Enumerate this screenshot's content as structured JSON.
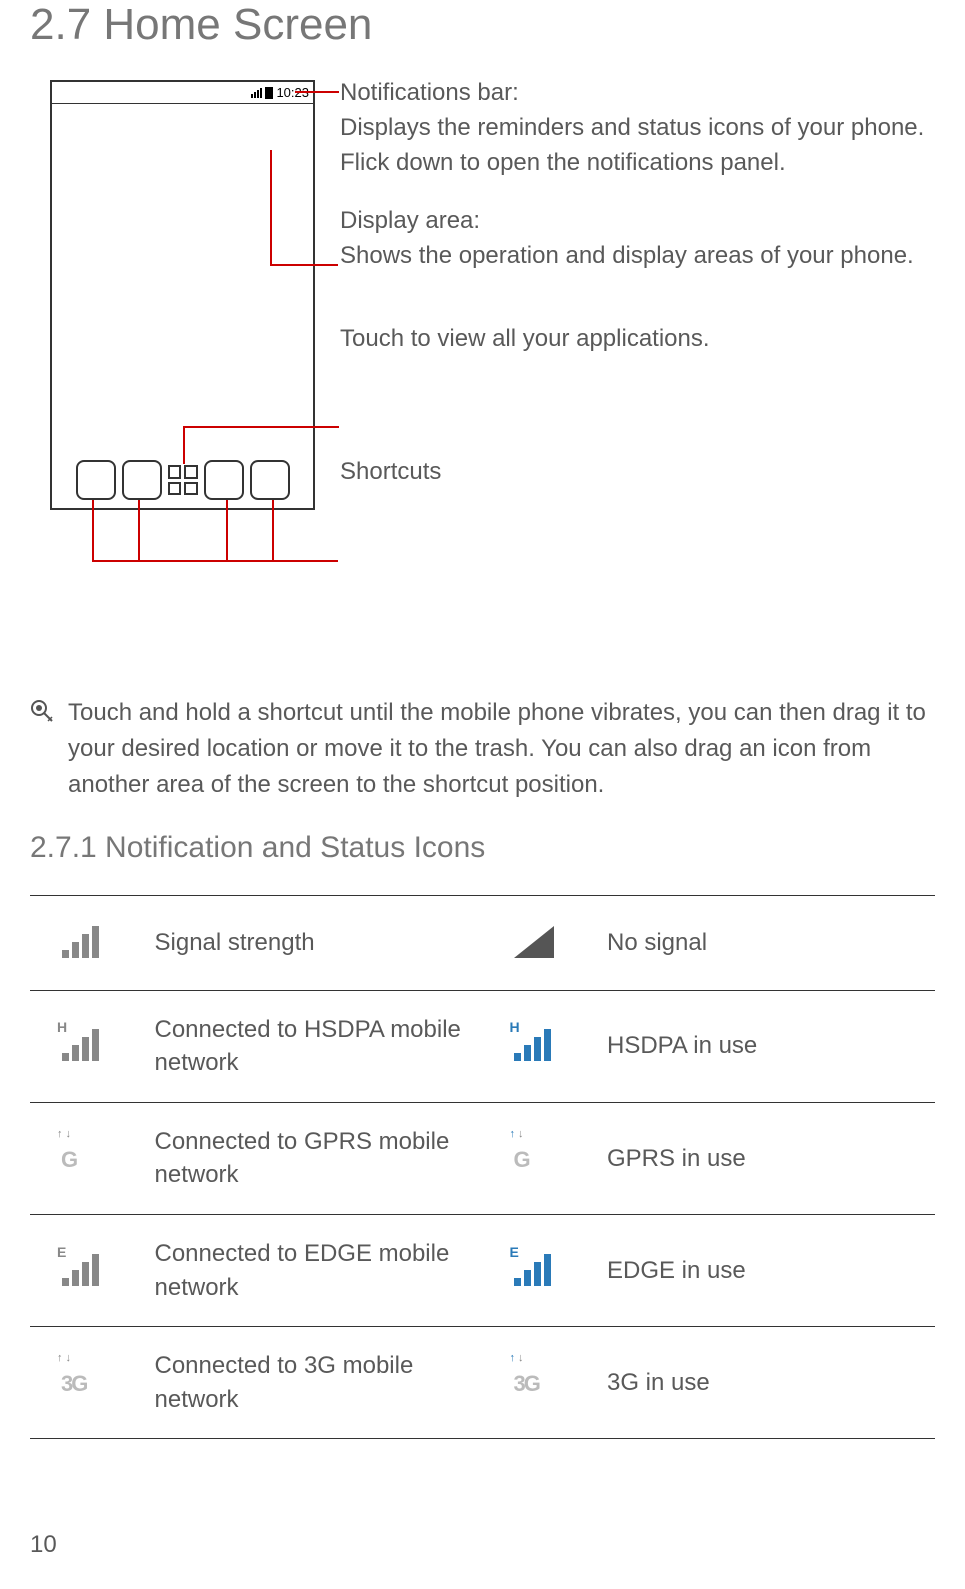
{
  "section_title": "2.7  Home Screen",
  "status_time": "10:23",
  "annotation_notif_title": "Notifications bar:",
  "annotation_notif_body": "Displays the reminders and status icons of your phone. Flick down to open the notifications panel.",
  "annotation_display_title": "Display area:",
  "annotation_display_body": "Shows the operation and display areas of your phone.",
  "annotation_apps": "Touch to view all your applications.",
  "annotation_shortcuts": "Shortcuts",
  "tip_text": "Touch and hold a shortcut until the mobile phone vibrates, you can then drag it to your desired location or move it to the trash. You can also drag an icon from another area of the screen to the shortcut position.",
  "subsection_title": "2.7.1   Notification and Status Icons",
  "table": {
    "rows": [
      {
        "l1": "Signal strength",
        "l2": "No signal"
      },
      {
        "l1": "Connected to HSDPA mobile network",
        "l2": "HSDPA in use"
      },
      {
        "l1": "Connected to GPRS mobile network",
        "l2": "GPRS in use"
      },
      {
        "l1": "Connected to EDGE mobile network",
        "l2": "EDGE in use"
      },
      {
        "l1": "Connected to 3G mobile network",
        "l2": "3G in use"
      }
    ]
  },
  "page_number": "10"
}
